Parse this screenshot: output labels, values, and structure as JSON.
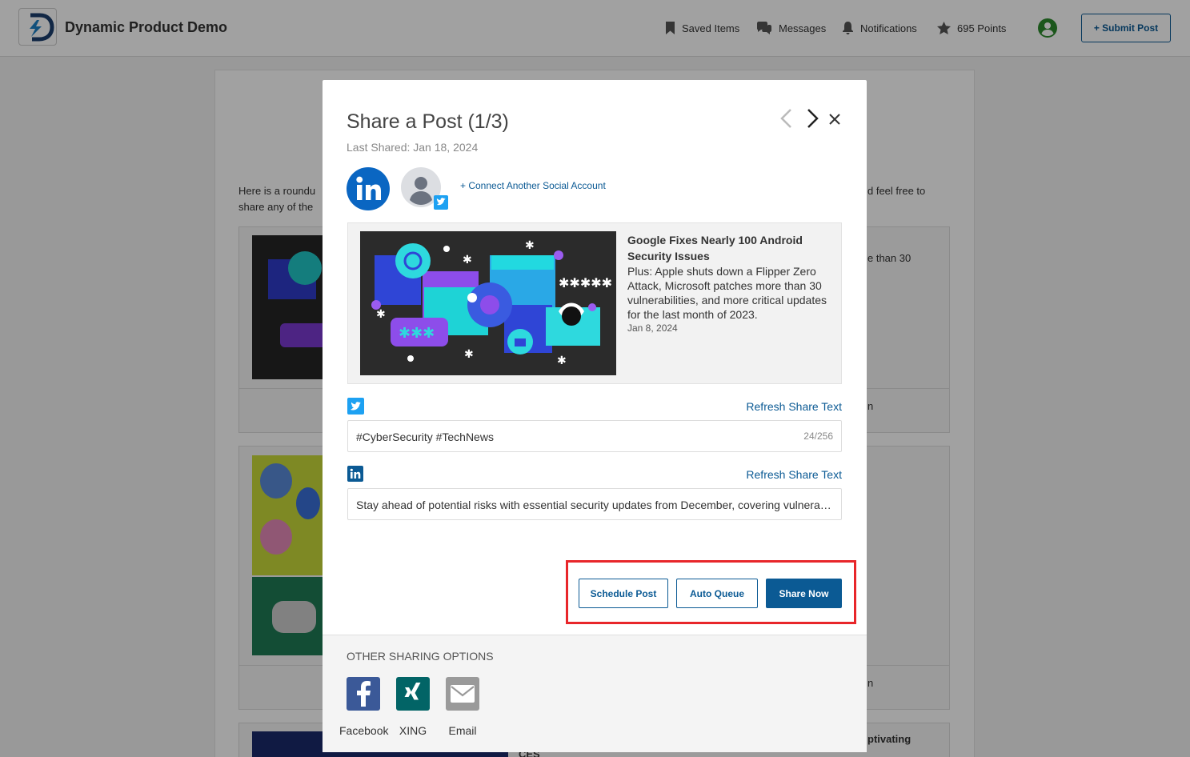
{
  "header": {
    "brand": "Dynamic Product Demo",
    "saved_items": "Saved Items",
    "messages": "Messages",
    "notifications": "Notifications",
    "points": "695 Points",
    "submit_post": "+ Submit Post"
  },
  "background": {
    "intro_line1_left": "Here is a roundu",
    "intro_line1_right": "d feel free to",
    "intro_line2_left": "share any of the",
    "item1_right": "e than 30",
    "item1_footer_right": "n",
    "item2_footer_right": "n",
    "item3_right": "ptivating",
    "item3_right2": "CES"
  },
  "modal": {
    "title": "Share a Post (1/3)",
    "last_shared": "Last Shared: Jan 18, 2024",
    "connect_account": "+ Connect Another Social Account",
    "preview": {
      "title": "Google Fixes Nearly 100 Android Security Issues",
      "description": "Plus: Apple shuts down a Flipper Zero Attack, Microsoft patches more than 30 vulnerabilities, and more critical updates for the last month of 2023.",
      "date": "Jan 8, 2024"
    },
    "twitter": {
      "refresh": "Refresh Share Text",
      "text": "#CyberSecurity #TechNews",
      "counter": "24/256"
    },
    "linkedin": {
      "refresh": "Refresh Share Text",
      "text": "Stay ahead of potential risks with essential security updates from December, covering vulnerabilities across Android, Apple and Microsoft."
    },
    "actions": {
      "schedule": "Schedule Post",
      "auto_queue": "Auto Queue",
      "share_now": "Share Now"
    },
    "other": {
      "heading": "OTHER SHARING OPTIONS",
      "options": [
        "Facebook",
        "XING",
        "Email"
      ]
    }
  },
  "colors": {
    "accent": "#0b5a94",
    "linkedin": "#0a66c2",
    "twitter": "#1da1f2",
    "facebook": "#3b5998",
    "xing": "#026466",
    "highlight": "#e8262a"
  }
}
